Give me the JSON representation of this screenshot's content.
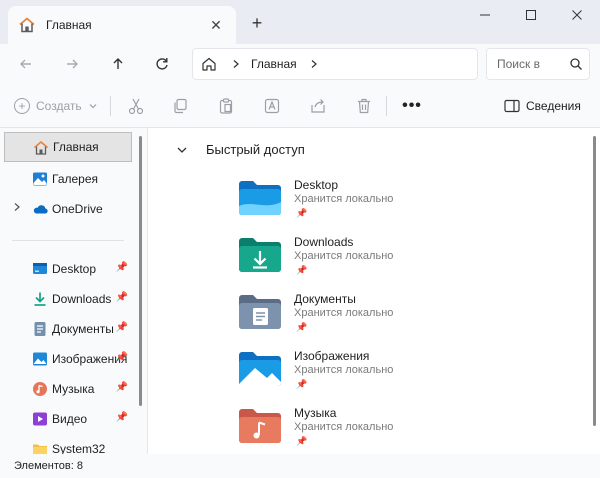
{
  "tab": {
    "title": "Главная",
    "close_glyph": "✕",
    "new_glyph": "+"
  },
  "window": {
    "minimize_glyph": "—",
    "maximize_glyph": "☐",
    "close_glyph": "✕"
  },
  "address": {
    "crumb": "Главная",
    "search_placeholder": "Поиск в"
  },
  "toolbar": {
    "create_label": "Создать",
    "more_glyph": "•••",
    "details_label": "Сведения"
  },
  "sidebar": {
    "items": [
      {
        "label": "Главная",
        "icon": "home-icon",
        "active": true
      },
      {
        "label": "Галерея",
        "icon": "gallery-icon"
      },
      {
        "label": "OneDrive",
        "icon": "onedrive-icon",
        "expandable": true
      },
      {
        "label": "Desktop",
        "icon": "desktop-icon",
        "pinned": true
      },
      {
        "label": "Downloads",
        "icon": "downloads-icon",
        "pinned": true
      },
      {
        "label": "Документы",
        "icon": "documents-icon",
        "pinned": true
      },
      {
        "label": "Изображения",
        "icon": "pictures-icon",
        "pinned": true
      },
      {
        "label": "Музыка",
        "icon": "music-icon",
        "pinned": true
      },
      {
        "label": "Видео",
        "icon": "videos-icon",
        "pinned": true
      },
      {
        "label": "System32",
        "icon": "folder-icon"
      }
    ]
  },
  "main": {
    "section_title": "Быстрый доступ",
    "folders": [
      {
        "name": "Desktop",
        "status": "Хранится локально",
        "icon": "desktop-folder-icon"
      },
      {
        "name": "Downloads",
        "status": "Хранится локально",
        "icon": "downloads-folder-icon"
      },
      {
        "name": "Документы",
        "status": "Хранится локально",
        "icon": "documents-folder-icon"
      },
      {
        "name": "Изображения",
        "status": "Хранится локально",
        "icon": "pictures-folder-icon"
      },
      {
        "name": "Музыка",
        "status": "Хранится локально",
        "icon": "music-folder-icon"
      }
    ]
  },
  "status": {
    "items_count": "Элементов: 8"
  },
  "colors": {
    "accent": "#0a6cc2",
    "home_orange": "#e8823a"
  }
}
